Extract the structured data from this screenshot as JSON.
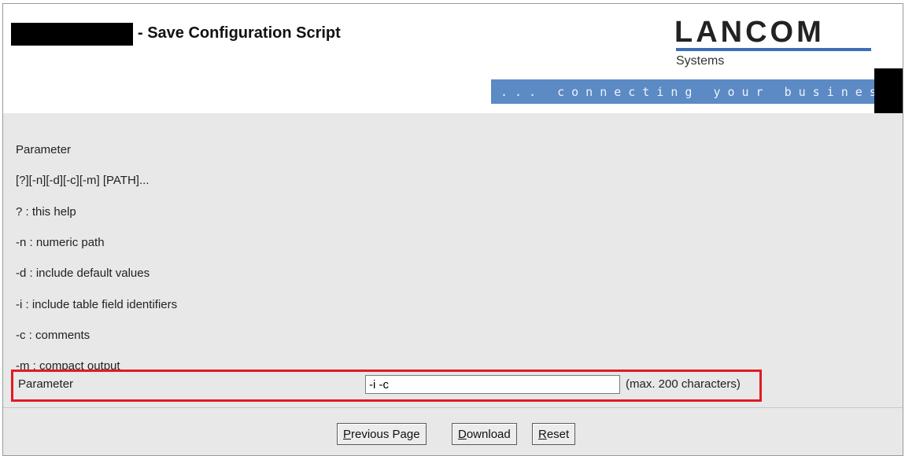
{
  "header": {
    "title_suffix": "- Save Configuration Script",
    "logo_text": "LANCOM",
    "logo_sub": "Systems",
    "tagline": "... connecting your business"
  },
  "help": {
    "lines": [
      "Parameter",
      "[?][-n][-d][-c][-m] [PATH]...",
      "? : this help",
      "-n : numeric path",
      "-d : include default values",
      "-i : include table field identifiers",
      "-c : comments",
      "-m : compact output"
    ]
  },
  "form": {
    "parameter_label": "Parameter",
    "parameter_value": "-i -c",
    "parameter_hint": "(max. 200 characters)"
  },
  "buttons": {
    "previous": {
      "accel": "P",
      "rest": "revious Page"
    },
    "download": {
      "accel": "D",
      "rest": "ownload"
    },
    "reset": {
      "accel": "R",
      "rest": "eset"
    }
  },
  "colors": {
    "highlight_border": "#e01b24",
    "tagline_bg": "#5b8ac4",
    "content_bg": "#e8e8e8"
  }
}
